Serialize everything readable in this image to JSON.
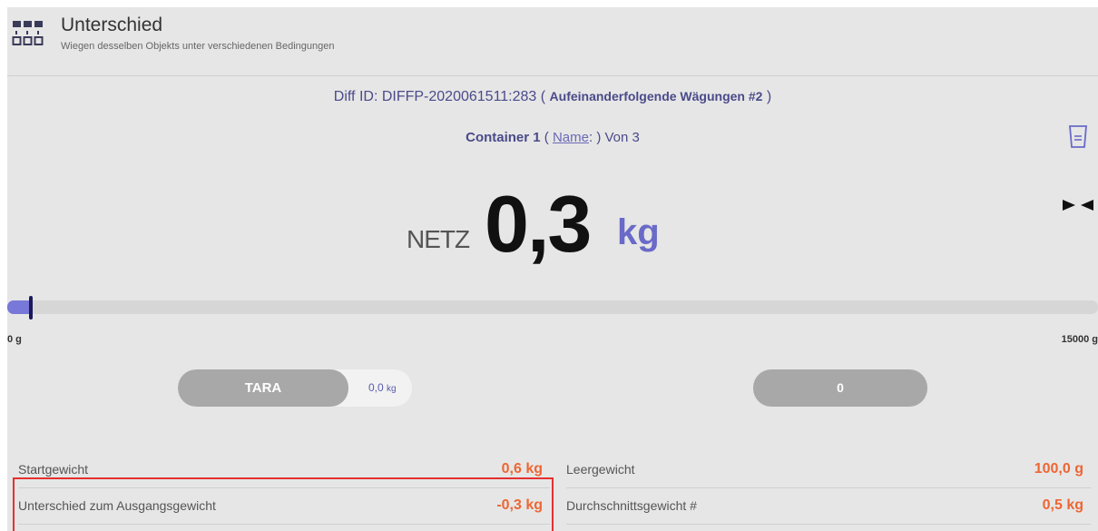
{
  "header": {
    "title": "Unterschied",
    "subtitle": "Wiegen desselben Objekts unter verschiedenen Bedingungen"
  },
  "diff": {
    "prefix": "Diff ID: DIFFP-2020061511:283 ( ",
    "mode": "Aufeinanderfolgende Wägungen #2",
    "suffix": " )"
  },
  "container": {
    "label": "Container 1",
    "open": " ( ",
    "name_link": "Name",
    "name_sep": ": ",
    "suffix": ") Von 3"
  },
  "weight": {
    "mode_label": "NETZ",
    "value": "0,3",
    "unit": "kg"
  },
  "capacity": {
    "min_label": "0 g",
    "max_label": "15000 g",
    "fill_fraction": 0.02
  },
  "buttons": {
    "tara_label": "TARA",
    "tara_value": "0,0",
    "tara_unit": "kg",
    "zero_label": "0"
  },
  "info": {
    "start_weight_label": "Startgewicht",
    "start_weight_value": "0,6  kg",
    "empty_weight_label": "Leergewicht",
    "empty_weight_value": "100,0  g",
    "diff_label": "Unterschied zum Ausgangsgewicht",
    "diff_value": "-0,3  kg",
    "avg_label": "Durchschnittsgewicht #",
    "avg_value": "0,5  kg"
  },
  "colors": {
    "accent": "#6a6ac8",
    "value_orange": "#ee6633",
    "highlight": "#e53030"
  }
}
